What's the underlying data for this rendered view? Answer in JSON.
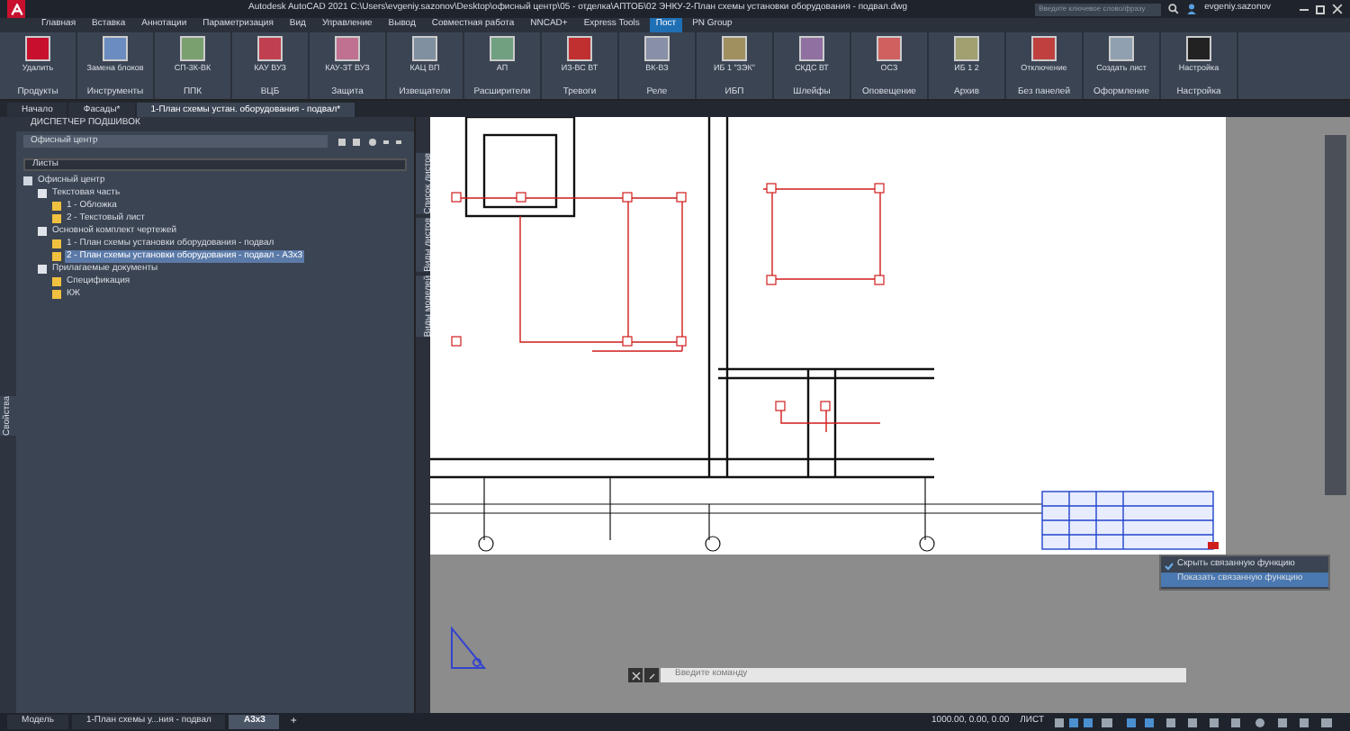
{
  "window": {
    "title": "Autodesk AutoCAD 2021   C:\\Users\\evgeniy.sazonov\\Desktop\\офисный центр\\05 - отделка\\АПТОБ\\02  ЭНКУ-2-План схемы установки оборудования - подвал.dwg",
    "search_placeholder": "Введите ключевое слово/фразу",
    "user": "evgeniy.sazonov"
  },
  "menu_tabs": [
    {
      "label": "Главная",
      "selected": false
    },
    {
      "label": "Вставка",
      "selected": false
    },
    {
      "label": "Аннотации",
      "selected": false
    },
    {
      "label": "Параметризация",
      "selected": false
    },
    {
      "label": "Вид",
      "selected": false
    },
    {
      "label": "Управление",
      "selected": false
    },
    {
      "label": "Вывод",
      "selected": false
    },
    {
      "label": "Совместная работа",
      "selected": false
    },
    {
      "label": "NNCAD+",
      "selected": false
    },
    {
      "label": "Express Tools",
      "selected": false
    },
    {
      "label": "Пост",
      "selected": true
    },
    {
      "label": "PN Group",
      "selected": false
    }
  ],
  "ribbon": [
    {
      "label": "Продукты",
      "buttons": [
        "Удалить"
      ]
    },
    {
      "label": "Инструменты",
      "buttons": [
        "Замена блоков"
      ]
    },
    {
      "label": "ППК",
      "buttons": [
        "СП-3К-ВК"
      ]
    },
    {
      "label": "ВЦБ",
      "buttons": [
        "КАУ ВУЗ"
      ]
    },
    {
      "label": "Защита",
      "buttons": [
        "КАУ-ЗТ ВУЗ"
      ]
    },
    {
      "label": "Извещатели",
      "buttons": [
        "КАЦ ВП"
      ]
    },
    {
      "label": "Расширители",
      "buttons": [
        "АП"
      ]
    },
    {
      "label": "Тревоги",
      "buttons": [
        "ИЗ-ВС ВТ"
      ]
    },
    {
      "label": "Реле",
      "buttons": [
        "ВК-ВЗ"
      ]
    },
    {
      "label": "ИБП",
      "buttons": [
        "ИБ 1 \"ЗЭК\""
      ]
    },
    {
      "label": "Шлейфы",
      "buttons": [
        "СКДС ВТ"
      ]
    },
    {
      "label": "Оповещение",
      "buttons": [
        "ОСЗ"
      ]
    },
    {
      "label": "Архив",
      "buttons": [
        "ИБ 1 2"
      ]
    },
    {
      "label": "Без панелей",
      "buttons": [
        "Отключение"
      ]
    },
    {
      "label": "Оформление",
      "buttons": [
        "Создать лист"
      ]
    },
    {
      "label": "Настройка",
      "buttons": [
        "Настройка"
      ]
    }
  ],
  "doc_tabs": [
    {
      "label": "Начало",
      "selected": false
    },
    {
      "label": "Фасады*",
      "selected": false
    },
    {
      "label": "1-План схемы устан. оборудования - подвал*",
      "selected": true
    }
  ],
  "sheet_set": {
    "title": "ДИСПЕТЧЕР ПОДШИВОК",
    "set_name": "Офисный центр",
    "list_header": "Листы",
    "tree": [
      {
        "label": "Офисный центр",
        "kind": "set",
        "selected": false,
        "children": [
          {
            "label": "Текстовая часть",
            "kind": "group",
            "selected": false,
            "children": [
              {
                "label": "1 - Обложка",
                "kind": "sheet",
                "selected": false
              },
              {
                "label": "2 - Текстовый лист",
                "kind": "sheet",
                "selected": false
              }
            ]
          },
          {
            "label": "Основной комплект чертежей",
            "kind": "group",
            "selected": false,
            "children": [
              {
                "label": "1 - План схемы установки оборудования - подвал",
                "kind": "sheet",
                "selected": false
              },
              {
                "label": "2 - План схемы установки оборудования - подвал - А3х3",
                "kind": "sheet",
                "selected": true
              }
            ]
          },
          {
            "label": "Прилагаемые документы",
            "kind": "group",
            "selected": false,
            "children": [
              {
                "label": "Спецификация",
                "kind": "sheet",
                "selected": false
              },
              {
                "label": "КЖ",
                "kind": "sheet",
                "selected": false
              }
            ]
          }
        ]
      }
    ],
    "side_tabs": [
      "Список листов",
      "Виды листов",
      "Виды моделей"
    ],
    "properties_tab": "Свойства"
  },
  "context_menu": [
    {
      "label": "Скрыть связанную функцию",
      "checked": true,
      "selected": false
    },
    {
      "label": "Показать связанную функцию",
      "checked": false,
      "selected": true
    }
  ],
  "command_placeholder": "Введите команду",
  "layout_tabs": [
    {
      "label": "Модель",
      "selected": false
    },
    {
      "label": "1-План схемы у...ния - подвал",
      "selected": false
    },
    {
      "label": "А3х3",
      "selected": true
    }
  ],
  "add_tab": "+",
  "status_bar": {
    "coordinates": "1000.00, 0.00, 0.00",
    "space": "ЛИСТ"
  }
}
